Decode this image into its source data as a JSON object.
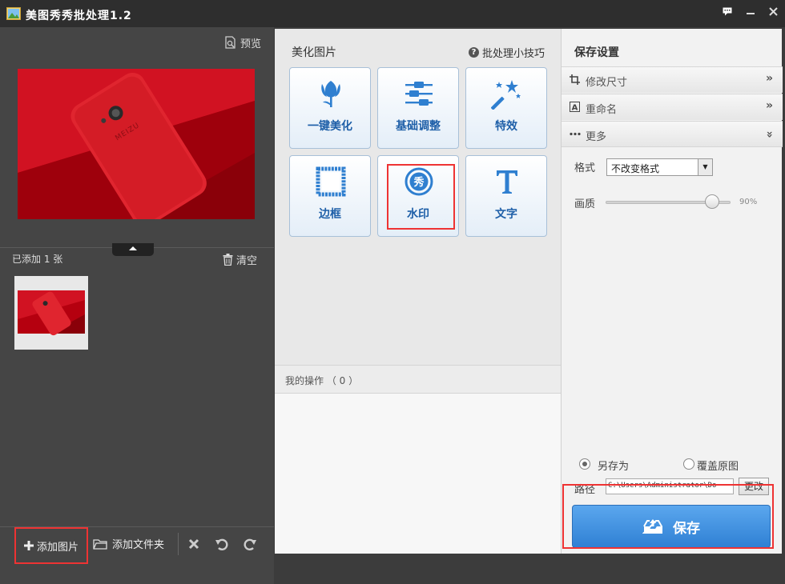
{
  "window": {
    "title": "美图秀秀批处理1.2",
    "controls": [
      "chat-icon",
      "minimize-icon",
      "close-icon"
    ]
  },
  "left": {
    "preview_label": "预览",
    "added_count": "已添加 1 张",
    "clear_label": "清空",
    "add_image_label": "添加图片",
    "add_folder_label": "添加文件夹"
  },
  "middle": {
    "title": "美化图片",
    "tips_label": "批处理小技巧",
    "tools": [
      {
        "label": "一键美化",
        "icon": "tulip-icon"
      },
      {
        "label": "基础调整",
        "icon": "sliders-icon"
      },
      {
        "label": "特效",
        "icon": "magic-wand-icon"
      },
      {
        "label": "边框",
        "icon": "frame-icon"
      },
      {
        "label": "水印",
        "icon": "watermark-icon"
      },
      {
        "label": "文字",
        "icon": "text-T-icon"
      }
    ],
    "ops_label": "我的操作 （ 0 ）"
  },
  "right": {
    "title": "保存设置",
    "accordion": [
      {
        "label": "修改尺寸",
        "icon": "crop-icon",
        "expanded": false
      },
      {
        "label": "重命名",
        "icon": "rename-icon",
        "expanded": false
      },
      {
        "label": "更多",
        "icon": "more-icon",
        "expanded": true
      }
    ],
    "format_label": "格式",
    "format_value": "不改变格式",
    "quality_label": "画质",
    "quality_percent": 90,
    "quality_value": "90%",
    "save_as_label": "另存为",
    "overwrite_label": "覆盖原图",
    "save_mode": "save_as",
    "path_label": "路径",
    "path_value": "C:\\Users\\Administrator\\Do",
    "change_label": "更改",
    "save_label": "保存"
  },
  "colors": {
    "accent_blue": "#2f80d4",
    "tool_label_blue": "#1e5fa8",
    "highlight_red": "#e33333",
    "panel_dark": "#454545"
  }
}
